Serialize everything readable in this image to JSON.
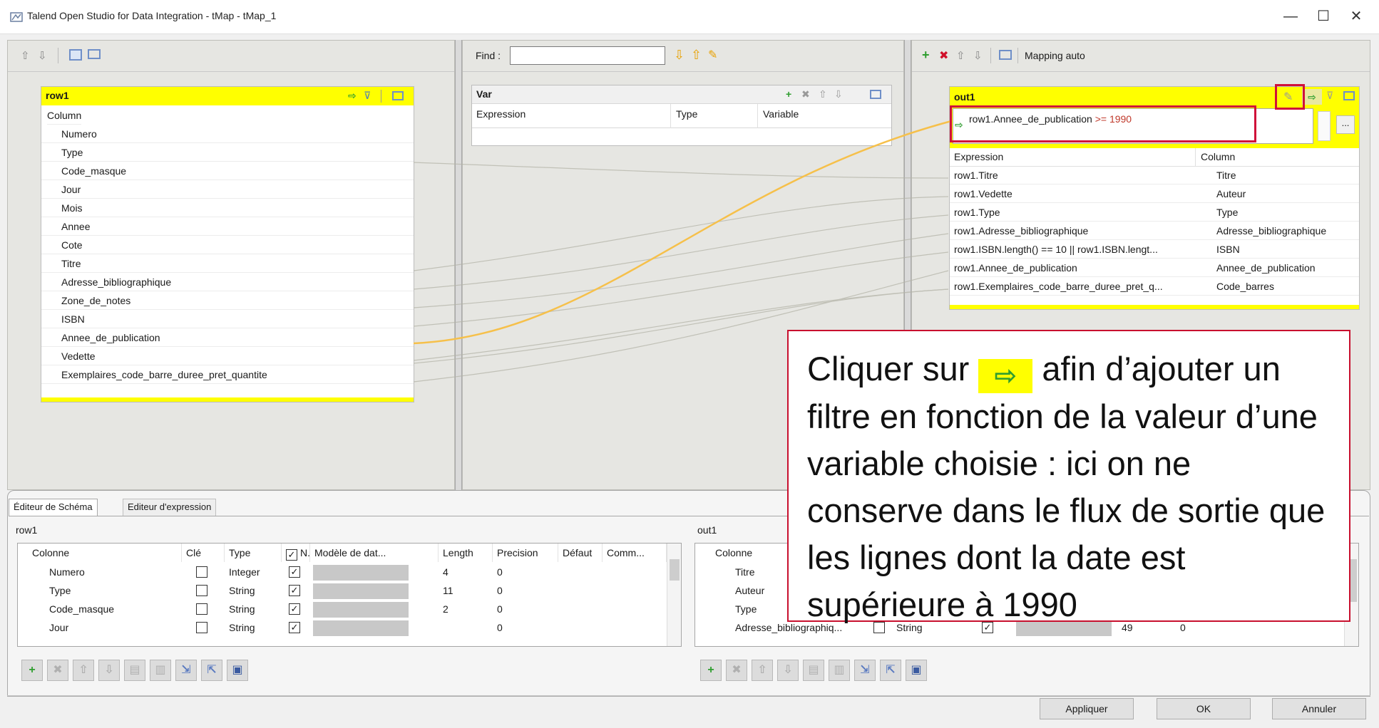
{
  "window": {
    "title": "Talend Open Studio for Data Integration - tMap - tMap_1",
    "minimize": "—",
    "maximize": "☐",
    "close": "✕"
  },
  "left_panel": {
    "toolbar_icons": [
      "arrow-up-icon",
      "arrow-down-icon",
      "minimize-tables-icon",
      "setting-icon"
    ],
    "input_table": {
      "name": "row1",
      "header": "Column",
      "columns": [
        "Numero",
        "Type",
        "Code_masque",
        "Jour",
        "Mois",
        "Annee",
        "Cote",
        "Titre",
        "Adresse_bibliographique",
        "Zone_de_notes",
        "ISBN",
        "Annee_de_publication",
        "Vedette",
        "Exemplaires_code_barre_duree_pret_quantite"
      ]
    }
  },
  "middle_panel": {
    "find_label": "Find :",
    "find_value": "",
    "var_table": {
      "name": "Var",
      "headers": [
        "Expression",
        "Type",
        "Variable"
      ]
    }
  },
  "right_panel": {
    "mapping_auto": "Mapping auto",
    "output_table": {
      "name": "out1",
      "filter_expression_prefix": "row1.Annee_de_publication ",
      "filter_expression_operator": ">= 1990",
      "headers": [
        "Expression",
        "Column"
      ],
      "rows": [
        {
          "expression": "row1.Titre",
          "column": "Titre"
        },
        {
          "expression": "row1.Vedette",
          "column": "Auteur"
        },
        {
          "expression": "row1.Type",
          "column": "Type"
        },
        {
          "expression": "row1.Adresse_bibliographique",
          "column": "Adresse_bibliographique"
        },
        {
          "expression": "row1.ISBN.length() == 10 || row1.ISBN.lengt...",
          "column": "ISBN"
        },
        {
          "expression": "row1.Annee_de_publication",
          "column": "Annee_de_publication"
        },
        {
          "expression": "row1.Exemplaires_code_barre_duree_pret_q...",
          "column": "Code_barres"
        }
      ]
    }
  },
  "bottom": {
    "tabs": [
      "Éditeur de Schéma",
      "Editeur d'expression"
    ],
    "left_schema": {
      "title": "row1",
      "headers": [
        "Colonne",
        "Clé",
        "Type",
        "N..",
        "Modèle de dat...",
        "Length",
        "Precision",
        "Défaut",
        "Comm..."
      ],
      "rows": [
        {
          "colonne": "Numero",
          "type": "Integer",
          "length": "4",
          "precision": "0"
        },
        {
          "colonne": "Type",
          "type": "String",
          "length": "11",
          "precision": "0"
        },
        {
          "colonne": "Code_masque",
          "type": "String",
          "length": "2",
          "precision": "0"
        },
        {
          "colonne": "Jour",
          "type": "String",
          "length": "",
          "precision": "0"
        }
      ]
    },
    "right_schema": {
      "title": "out1",
      "headers": [
        "Colonne"
      ],
      "rows": [
        {
          "colonne": "Titre"
        },
        {
          "colonne": "Auteur"
        },
        {
          "colonne": "Type"
        },
        {
          "colonne": "Adresse_bibliographiq...",
          "type": "String",
          "length": "49",
          "precision": "0"
        }
      ]
    },
    "buttons": {
      "apply": "Appliquer",
      "ok": "OK",
      "cancel": "Annuler"
    }
  },
  "annotation": {
    "text_before": "Cliquer sur ",
    "text_after": " afin d’ajouter un filtre en fonction de la valeur d’une variable choisie : ici on ne conserve dans le flux de sortie que les lignes dont la date est supérieure à 1990",
    "icon": "add-filter-icon"
  },
  "colors": {
    "table_header": "#ffff00",
    "link_line": "#f6c04a",
    "highlight": "#d0103a",
    "expression_operator": "#c0392b"
  }
}
